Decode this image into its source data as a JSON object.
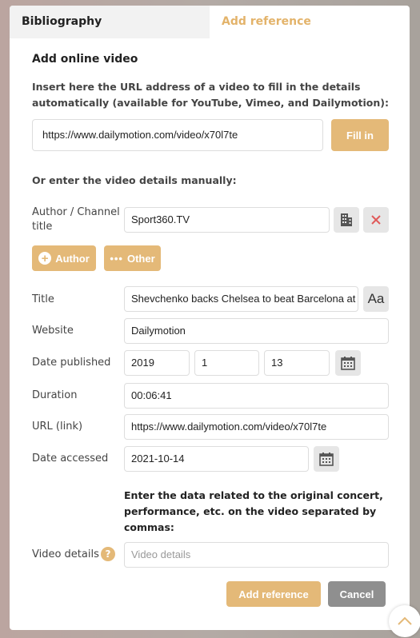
{
  "tabs": {
    "bibliography": "Bibliography",
    "add_reference": "Add reference"
  },
  "heading": "Add online video",
  "url_instructions": "Insert here the URL address of a video to fill in the details automatically (available for YouTube, Vimeo, and Dailymotion):",
  "url_input": "https://www.dailymotion.com/video/x70l7te",
  "fill_in": "Fill in",
  "manual_heading": "Or enter the video details manually:",
  "fields": {
    "author_label": "Author / Channel title",
    "author_value": "Sport360.TV",
    "add_author": "Author",
    "add_other": "Other",
    "title_label": "Title",
    "title_value": "Shevchenko backs Chelsea to beat Barcelona at",
    "title_case": "Aa",
    "website_label": "Website",
    "website_value": "Dailymotion",
    "date_published_label": "Date published",
    "year": "2019",
    "month": "1",
    "day": "13",
    "duration_label": "Duration",
    "duration_value": "00:06:41",
    "url_label": "URL (link)",
    "url_value": "https://www.dailymotion.com/video/x70l7te",
    "date_accessed_label": "Date accessed",
    "date_accessed_value": "2021-10-14",
    "original_note": "Enter the data related to the original concert, performance, etc. on the video separated by commas:",
    "video_details_label": "Video details",
    "video_details_placeholder": "Video details",
    "help": "?"
  },
  "actions": {
    "add_reference": "Add reference",
    "cancel": "Cancel"
  },
  "colors": {
    "accent": "#e4b978",
    "remove": "#e05a5a",
    "cancel": "#8f8f8f"
  }
}
